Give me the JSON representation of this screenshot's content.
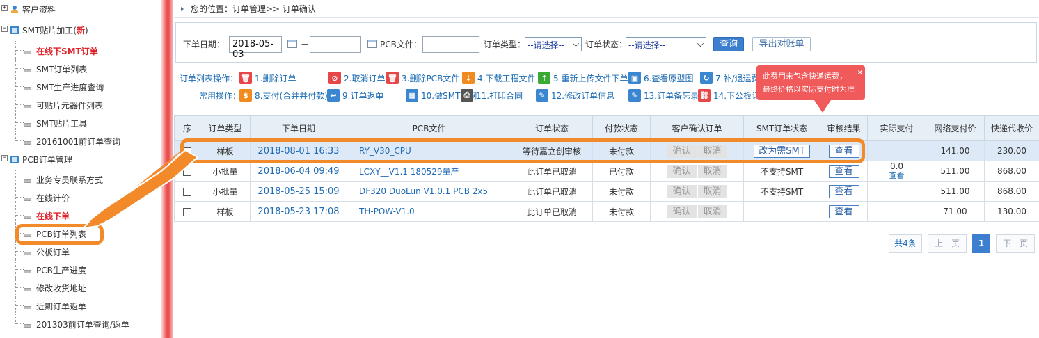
{
  "sidebar": {
    "groups": [
      {
        "label": "客户资料",
        "expander": "+"
      },
      {
        "label": "SMT贴片加工(",
        "badge": "新",
        "suffix": ")",
        "expander": "−"
      },
      {
        "label": "PCB订单管理",
        "expander": "−"
      }
    ],
    "smt_items": [
      {
        "label": "在线下SMT订单",
        "highlight": true
      },
      {
        "label": "SMT订单列表"
      },
      {
        "label": "SMT生产进度查询"
      },
      {
        "label": "可贴片元器件列表"
      },
      {
        "label": "SMT贴片工具"
      },
      {
        "label": "20161001前订单查询"
      }
    ],
    "pcb_items": [
      {
        "label": "业务专员联系方式"
      },
      {
        "label": "在线计价"
      },
      {
        "label": "在线下单",
        "highlight": true
      },
      {
        "label": "PCB订单列表",
        "selected": true
      },
      {
        "label": "公板订单"
      },
      {
        "label": "PCB生产进度"
      },
      {
        "label": "修改收货地址"
      },
      {
        "label": "近期订单返单"
      },
      {
        "label": "201303前订单查询/返单"
      }
    ]
  },
  "breadcrumb": {
    "text": "您的位置：订单管理>> 订单确认"
  },
  "filters": {
    "date_label": "下单日期：",
    "date_from": "2018-05-03",
    "date_to": "",
    "dash": "－",
    "pcb_label": "PCB文件：",
    "pcb_value": "",
    "type_label": "订单类型：",
    "type_value": "--请选择--",
    "status_label": "订单状态：",
    "status_value": "--请选择--",
    "query_button": "查询",
    "export_button": "导出对账单"
  },
  "operations": {
    "list_label": "订单列表操作：",
    "common_label": "常用操作：",
    "row1": [
      {
        "label": "1.删除订单",
        "icon": "trash-icon",
        "color": "#e8474a"
      },
      {
        "label": "2.取消订单",
        "icon": "ban-icon",
        "color": "#e8474a"
      },
      {
        "label": "3.删除PCB文件",
        "icon": "trash-icon",
        "color": "#e8474a"
      },
      {
        "label": "4.下载工程文件",
        "icon": "download-icon",
        "color": "#f08c1f"
      },
      {
        "label": "5.重新上传文件下单",
        "icon": "upload-icon",
        "color": "#3aaa35"
      },
      {
        "label": "6.查看原型图",
        "icon": "image-icon",
        "color": "#3b86d0"
      },
      {
        "label": "7.补/退运费",
        "icon": "refund-icon",
        "color": "#3b86d0"
      }
    ],
    "row2": [
      {
        "label": "8.支付(合并并付款)",
        "icon": "pay-icon",
        "color": "#f08c1f"
      },
      {
        "label": "9.订单返单",
        "icon": "return-icon",
        "color": "#3b86d0"
      },
      {
        "label": "10.做SMT钢网",
        "icon": "grid-icon",
        "color": "#3b86d0"
      },
      {
        "label": "11.打印合同",
        "icon": "printer-icon",
        "color": "#555555"
      },
      {
        "label": "12.修改订单信息",
        "icon": "edit-icon",
        "color": "#3b86d0"
      },
      {
        "label": "13.订单备忘录",
        "icon": "memo-icon",
        "color": "#3b86d0"
      },
      {
        "label": "14.下公板订单",
        "icon": "link-icon",
        "color": "#e8474a"
      }
    ]
  },
  "tip": {
    "line1": "此费用未包含快递运费，",
    "line2": "最终价格以实际支付时为准",
    "close": "×"
  },
  "table": {
    "headers": [
      "序",
      "订单类型",
      "下单日期",
      "PCB文件",
      "订单状态",
      "付款状态",
      "客户确认订单",
      "SMT订单状态",
      "审核结果",
      "实际支付",
      "网络支付价",
      "快递代收价"
    ],
    "confirm_label": "确认",
    "cancel_label": "取消",
    "view_label": "查看",
    "rows": [
      {
        "type": "样板",
        "date": "2018-08-01 16:33",
        "pcb": "RY_V30_CPU",
        "status": "等待嘉立创审核",
        "pay": "未付款",
        "pay_kind": "unpaid",
        "smt": "改为需SMT",
        "smt_kind": "button",
        "paid": "",
        "paid_link": "",
        "net_price": "141.00",
        "express": "230.00",
        "express_grey": false,
        "selected": true
      },
      {
        "type": "小批量",
        "date": "2018-06-04 09:49",
        "pcb": "LCXY__V1.1 180529量产",
        "status": "此订单已取消",
        "pay": "已付款",
        "pay_kind": "paid",
        "smt": "不支持SMT",
        "smt_kind": "text",
        "paid": "0.0",
        "paid_link": "查看",
        "net_price": "511.00",
        "express": "868.00",
        "express_grey": true,
        "selected": false
      },
      {
        "type": "小批量",
        "date": "2018-05-25 15:09",
        "pcb": "DF320 DuoLun V1.0.1 PCB 2x5",
        "status": "此订单已取消",
        "pay": "未付款",
        "pay_kind": "unpaid",
        "smt": "不支持SMT",
        "smt_kind": "text",
        "paid": "",
        "paid_link": "",
        "net_price": "511.00",
        "express": "868.00",
        "express_grey": false,
        "selected": false
      },
      {
        "type": "样板",
        "date": "2018-05-23 17:08",
        "pcb": "TH-POW-V1.0",
        "status": "此订单已取消",
        "pay": "未付款",
        "pay_kind": "unpaid",
        "smt": "",
        "smt_kind": "none",
        "paid": "",
        "paid_link": "",
        "net_price": "71.00",
        "express": "130.00",
        "express_grey": false,
        "selected": false
      }
    ]
  },
  "pager": {
    "total": "共4条",
    "prev": "上一页",
    "current": "1",
    "next": "下一页"
  },
  "colors": {
    "accent": "#3d7fcf",
    "highlight": "#f28a2a",
    "danger": "#e0232a",
    "tip": "#f05a5a"
  }
}
